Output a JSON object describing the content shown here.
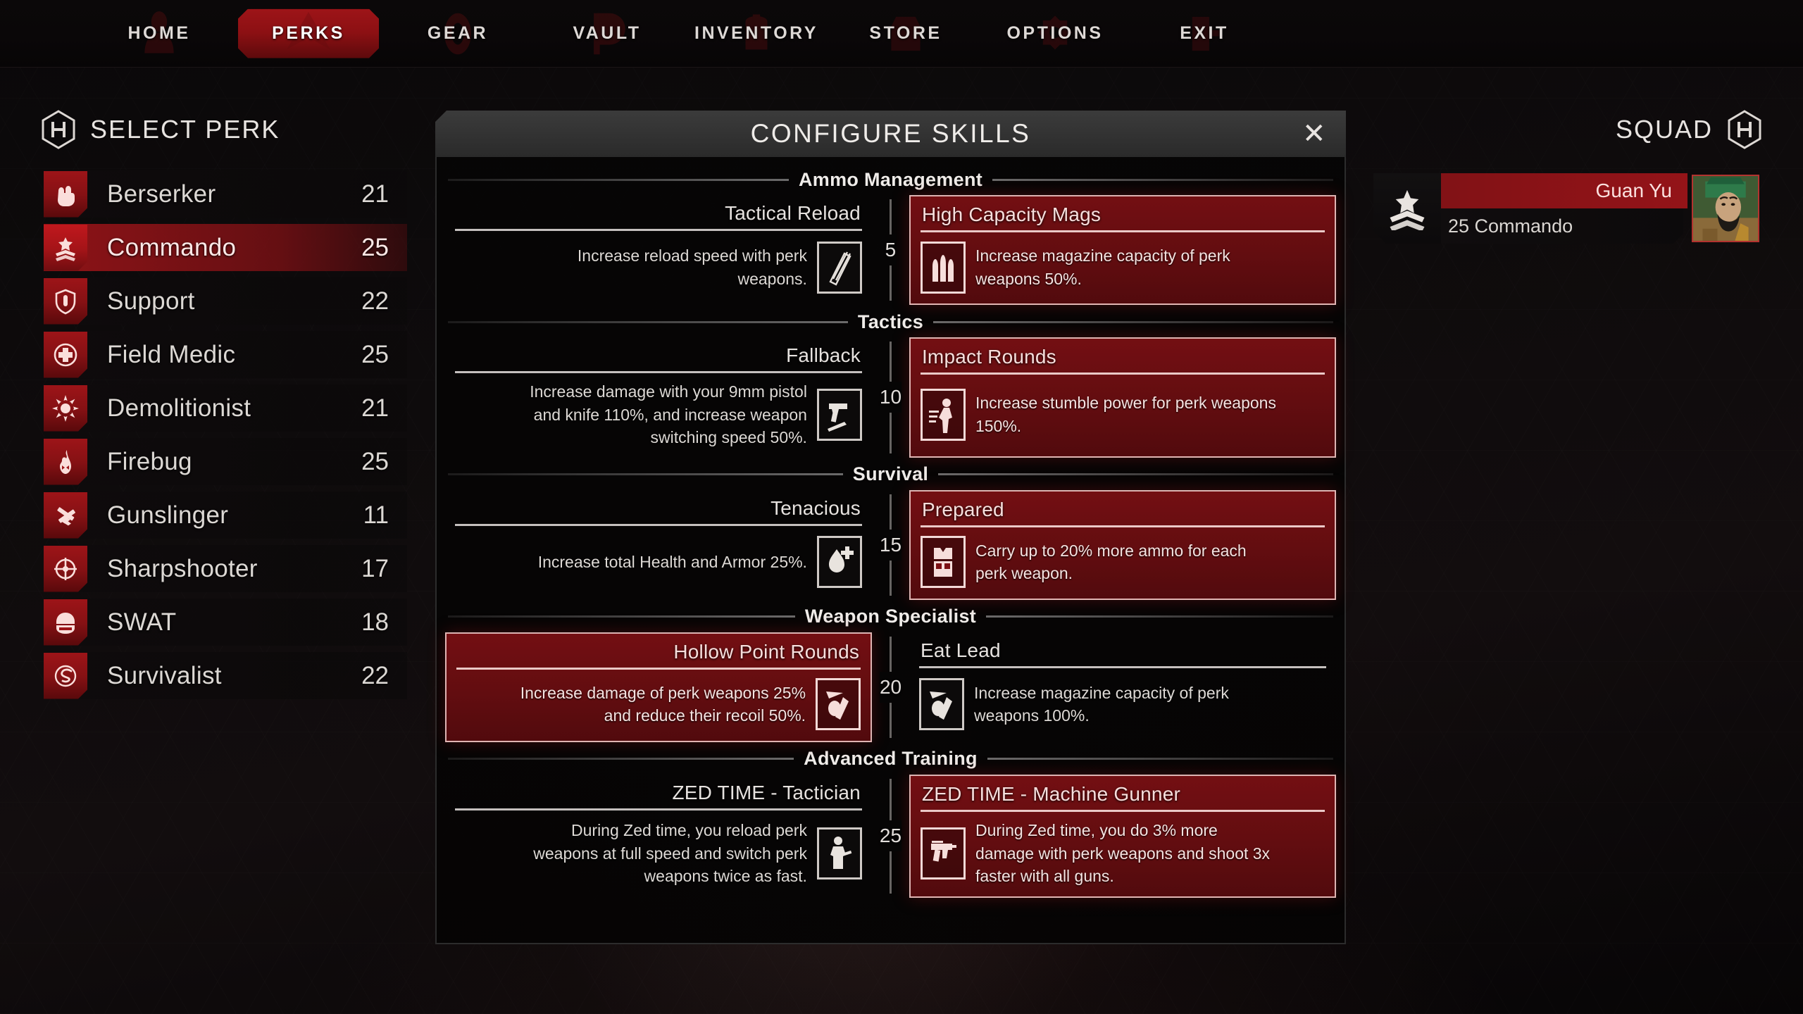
{
  "topnav": {
    "items": [
      {
        "label": "HOME",
        "icon": "home-silhouette-icon",
        "active": false
      },
      {
        "label": "PERKS",
        "icon": "chevron-rank-icon",
        "active": true
      },
      {
        "label": "GEAR",
        "icon": "gear-icon",
        "active": false
      },
      {
        "label": "VAULT",
        "icon": "vault-icon",
        "active": false
      },
      {
        "label": "INVENTORY",
        "icon": "backpack-icon",
        "active": false
      },
      {
        "label": "STORE",
        "icon": "store-icon",
        "active": false
      },
      {
        "label": "OPTIONS",
        "icon": "options-gear-icon",
        "active": false
      },
      {
        "label": "EXIT",
        "icon": "exit-icon",
        "active": false
      }
    ]
  },
  "sidebar": {
    "title": "SELECT PERK",
    "items": [
      {
        "name": "Berserker",
        "level": "21",
        "icon": "fist-icon",
        "selected": false
      },
      {
        "name": "Commando",
        "level": "25",
        "icon": "chevron-star-icon",
        "selected": true
      },
      {
        "name": "Support",
        "level": "22",
        "icon": "shield-icon",
        "selected": false
      },
      {
        "name": "Field Medic",
        "level": "25",
        "icon": "medic-cross-icon",
        "selected": false
      },
      {
        "name": "Demolitionist",
        "level": "21",
        "icon": "explosion-icon",
        "selected": false
      },
      {
        "name": "Firebug",
        "level": "25",
        "icon": "flame-skull-icon",
        "selected": false
      },
      {
        "name": "Gunslinger",
        "level": "11",
        "icon": "crossed-pistols-icon",
        "selected": false
      },
      {
        "name": "Sharpshooter",
        "level": "17",
        "icon": "crosshair-icon",
        "selected": false
      },
      {
        "name": "SWAT",
        "level": "18",
        "icon": "helmet-icon",
        "selected": false
      },
      {
        "name": "Survivalist",
        "level": "22",
        "icon": "survivalist-icon",
        "selected": false
      }
    ]
  },
  "dialog": {
    "title": "CONFIGURE SKILLS",
    "close_label": "✕",
    "tiers": [
      {
        "name": "Ammo Management",
        "level": "5",
        "left": {
          "title": "Tactical Reload",
          "desc": "Increase reload speed with perk weapons.",
          "icon": "magazine-icon",
          "active": false
        },
        "right": {
          "title": "High Capacity Mags",
          "desc": "Increase magazine capacity of perk weapons 50%.",
          "icon": "bullets-icon",
          "active": true
        }
      },
      {
        "name": "Tactics",
        "level": "10",
        "left": {
          "title": "Fallback",
          "desc": "Increase damage with your 9mm pistol and knife 110%, and increase weapon switching speed 50%.",
          "icon": "pistol-knife-icon",
          "active": false
        },
        "right": {
          "title": "Impact Rounds",
          "desc": "Increase stumble power for perk weapons 150%.",
          "icon": "stumble-figure-icon",
          "active": true
        }
      },
      {
        "name": "Survival",
        "level": "15",
        "left": {
          "title": "Tenacious",
          "desc": "Increase total Health and Armor 25%.",
          "icon": "health-drop-icon",
          "active": false
        },
        "right": {
          "title": "Prepared",
          "desc": "Carry up to 20% more ammo for each perk weapon.",
          "icon": "ammo-vest-icon",
          "active": true
        }
      },
      {
        "name": "Weapon Specialist",
        "level": "20",
        "left": {
          "title": "Hollow Point Rounds",
          "desc": "Increase damage of perk weapons 25% and reduce their recoil 50%.",
          "icon": "hollow-point-icon",
          "active": true
        },
        "right": {
          "title": "Eat Lead",
          "desc": "Increase magazine capacity of perk weapons 100%.",
          "icon": "hollow-point-icon",
          "active": false
        }
      },
      {
        "name": "Advanced Training",
        "level": "25",
        "left": {
          "title": "ZED TIME - Tactician",
          "desc": "During Zed time, you reload perk weapons at full speed and switch perk weapons twice as fast.",
          "icon": "soldier-reload-icon",
          "active": false
        },
        "right": {
          "title": "ZED TIME - Machine Gunner",
          "desc": "During Zed time, you do 3% more damage with perk weapons and shoot 3x faster with all guns.",
          "icon": "machine-gun-icon",
          "active": true
        }
      }
    ]
  },
  "squad": {
    "title": "SQUAD",
    "member": {
      "name": "Guan Yu",
      "subtitle": "25 Commando",
      "rank_icon": "chevron-star-icon",
      "avatar": "guan-yu-portrait"
    }
  },
  "colors": {
    "accent_red": "#9d1418",
    "accent_red_bright": "#c0181d",
    "panel_gray": "#323232",
    "text_light": "#e6e2df"
  }
}
